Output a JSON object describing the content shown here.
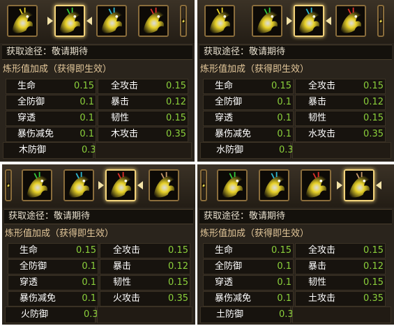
{
  "colors": {
    "yellow_dragon": "#e8d22a",
    "green_dragon": "#35c83a",
    "cyan_dragon": "#2fb8d0",
    "red_dragon": "#e0302a",
    "brown_dragon": "#c89a6a",
    "value_green": "#8bd03b",
    "title_gold": "#e3c79a"
  },
  "panels": [
    {
      "icons": [
        "yellow-dragon-icon",
        "green-dragon-icon",
        "cyan-dragon-icon",
        "red-dragon-icon"
      ],
      "selected": "green-dragon-icon",
      "source_label": "获取途径：",
      "source_value": "敬请期待",
      "bonus_title": "炼形值加成（获得即生效）",
      "stats": [
        {
          "label": "生命",
          "value": "0.15"
        },
        {
          "label": "全攻击",
          "value": "0.15"
        },
        {
          "label": "全防御",
          "value": "0.1"
        },
        {
          "label": "暴击",
          "value": "0.12"
        },
        {
          "label": "穿透",
          "value": "0.1"
        },
        {
          "label": "韧性",
          "value": "0.15"
        },
        {
          "label": "暴伤减免",
          "value": "0.1"
        },
        {
          "label": "木攻击",
          "value": "0.35"
        }
      ],
      "last": {
        "label": "木防御",
        "value": "0.3"
      }
    },
    {
      "icons": [
        "yellow-dragon-icon",
        "green-dragon-icon",
        "cyan-dragon-icon",
        "red-dragon-icon"
      ],
      "selected": "cyan-dragon-icon",
      "source_label": "获取途径：",
      "source_value": "敬请期待",
      "bonus_title": "炼形值加成（获得即生效）",
      "stats": [
        {
          "label": "生命",
          "value": "0.15"
        },
        {
          "label": "全攻击",
          "value": "0.15"
        },
        {
          "label": "全防御",
          "value": "0.1"
        },
        {
          "label": "暴击",
          "value": "0.12"
        },
        {
          "label": "穿透",
          "value": "0.1"
        },
        {
          "label": "韧性",
          "value": "0.15"
        },
        {
          "label": "暴伤减免",
          "value": "0.1"
        },
        {
          "label": "水攻击",
          "value": "0.35"
        }
      ],
      "last": {
        "label": "水防御",
        "value": "0.3"
      }
    },
    {
      "icons": [
        "green-dragon-icon",
        "cyan-dragon-icon",
        "red-dragon-icon",
        "brown-dragon-icon"
      ],
      "selected": "red-dragon-icon",
      "source_label": "获取途径：",
      "source_value": "敬请期待",
      "bonus_title": "炼形值加成（获得即生效）",
      "stats": [
        {
          "label": "生命",
          "value": "0.15"
        },
        {
          "label": "全攻击",
          "value": "0.15"
        },
        {
          "label": "全防御",
          "value": "0.1"
        },
        {
          "label": "暴击",
          "value": "0.12"
        },
        {
          "label": "穿透",
          "value": "0.1"
        },
        {
          "label": "韧性",
          "value": "0.15"
        },
        {
          "label": "暴伤减免",
          "value": "0.1"
        },
        {
          "label": "火攻击",
          "value": "0.35"
        }
      ],
      "last": {
        "label": "火防御",
        "value": "0.3"
      }
    },
    {
      "icons": [
        "green-dragon-icon",
        "cyan-dragon-icon",
        "red-dragon-icon",
        "brown-dragon-icon"
      ],
      "selected": "brown-dragon-icon",
      "source_label": "获取途径：",
      "source_value": "敬请期待",
      "bonus_title": "炼形值加成（获得即生效）",
      "stats": [
        {
          "label": "生命",
          "value": "0.15"
        },
        {
          "label": "全攻击",
          "value": "0.15"
        },
        {
          "label": "全防御",
          "value": "0.1"
        },
        {
          "label": "暴击",
          "value": "0.12"
        },
        {
          "label": "穿透",
          "value": "0.1"
        },
        {
          "label": "韧性",
          "value": "0.15"
        },
        {
          "label": "暴伤减免",
          "value": "0.1"
        },
        {
          "label": "土攻击",
          "value": "0.35"
        }
      ],
      "last": {
        "label": "土防御",
        "value": "0.3"
      }
    }
  ]
}
